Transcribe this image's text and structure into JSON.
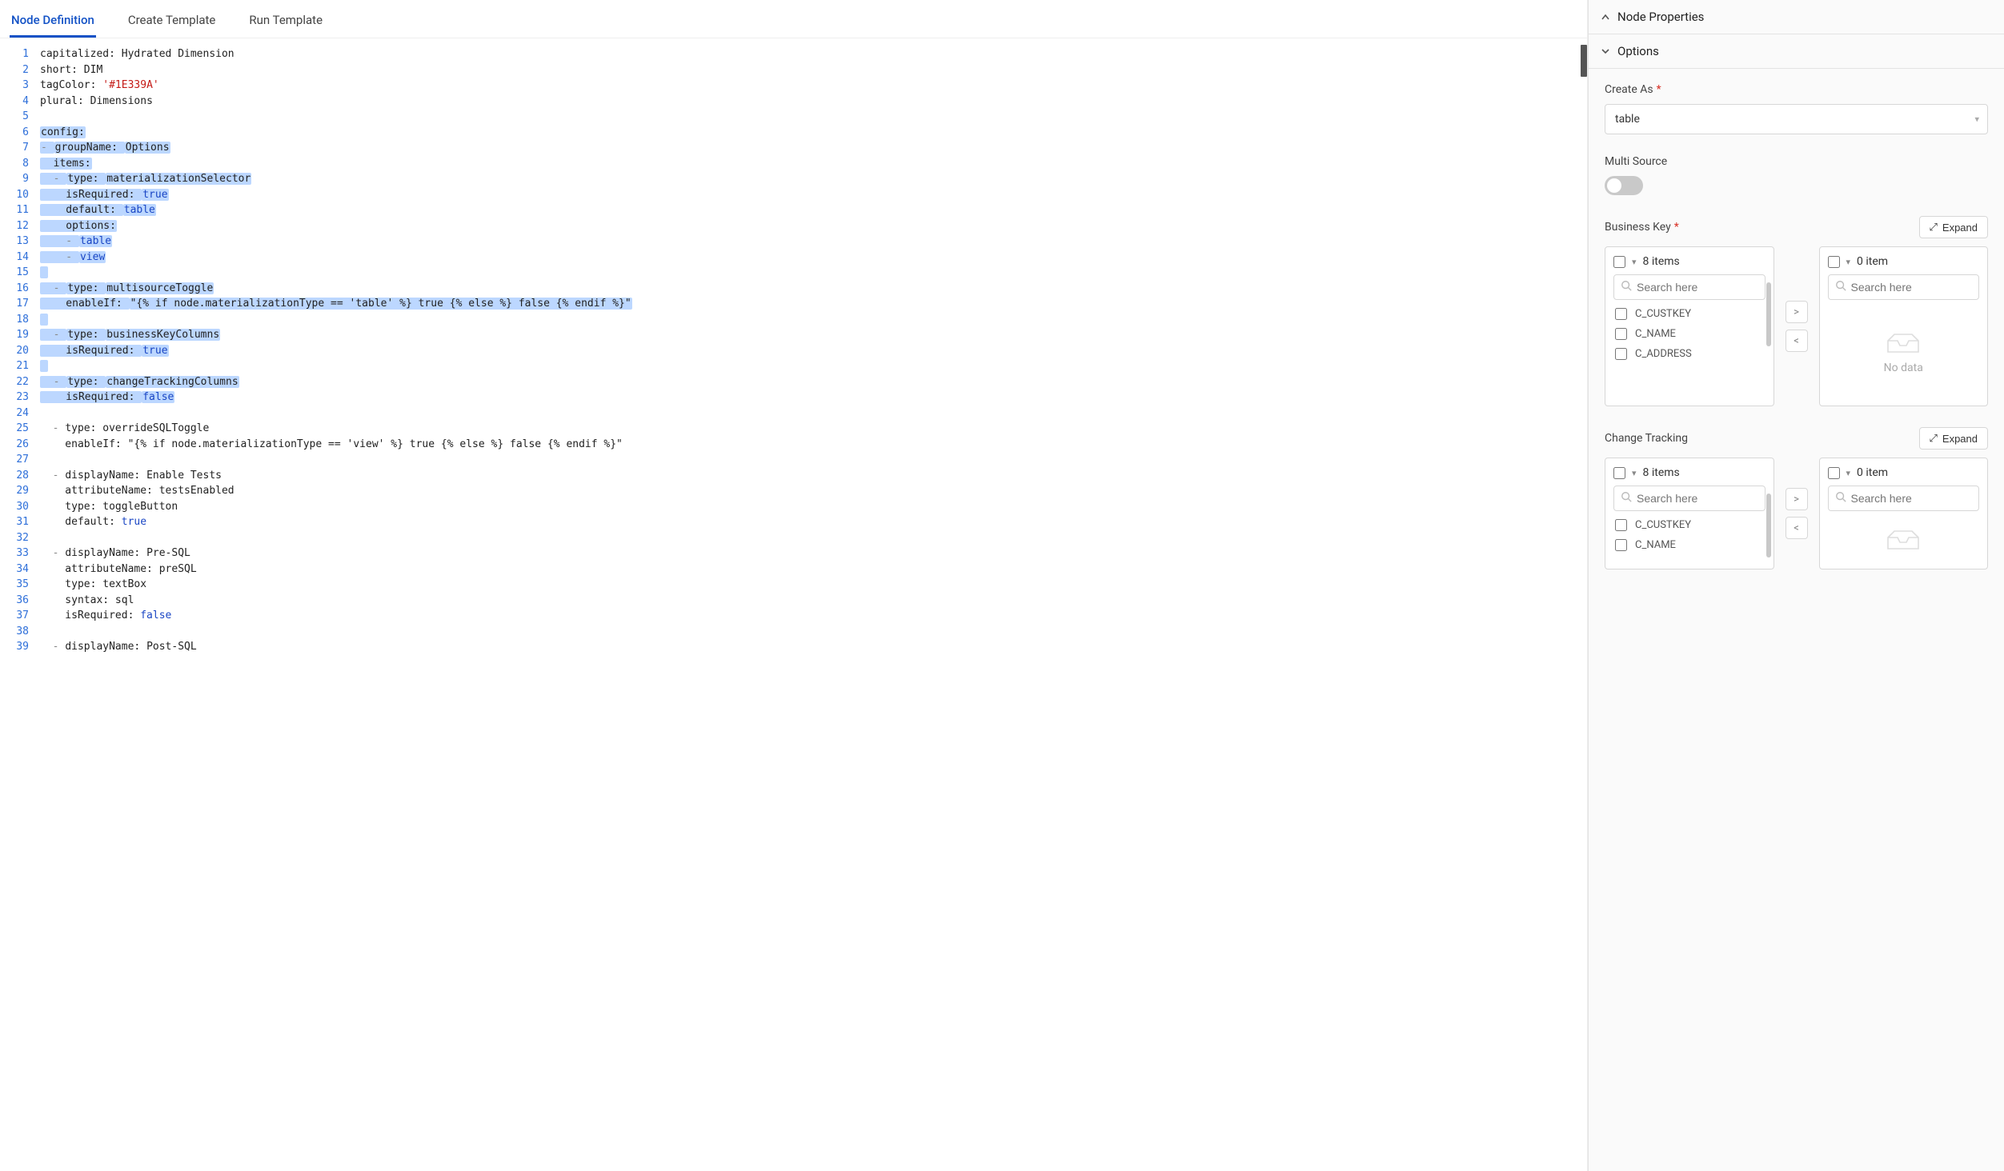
{
  "tabs": [
    {
      "label": "Node Definition",
      "active": true
    },
    {
      "label": "Create Template",
      "active": false
    },
    {
      "label": "Run Template",
      "active": false
    }
  ],
  "editor": {
    "lines": [
      {
        "n": 1,
        "segments": [
          {
            "t": "capitalized: ",
            "c": "tok-key"
          },
          {
            "t": "Hydrated Dimension",
            "c": ""
          }
        ]
      },
      {
        "n": 2,
        "segments": [
          {
            "t": "short: ",
            "c": "tok-key"
          },
          {
            "t": "DIM",
            "c": ""
          }
        ]
      },
      {
        "n": 3,
        "segments": [
          {
            "t": "tagColor: ",
            "c": "tok-key"
          },
          {
            "t": "'#1E339A'",
            "c": "tok-str"
          }
        ]
      },
      {
        "n": 4,
        "segments": [
          {
            "t": "plural: ",
            "c": "tok-key"
          },
          {
            "t": "Dimensions",
            "c": ""
          }
        ]
      },
      {
        "n": 5,
        "segments": []
      },
      {
        "n": 6,
        "segments": [
          {
            "t": "config:",
            "c": "tok-key",
            "hl": true
          }
        ]
      },
      {
        "n": 7,
        "segments": [
          {
            "t": "- ",
            "c": "tok-dash",
            "hl": true
          },
          {
            "t": "groupName: ",
            "c": "tok-key",
            "hl": true
          },
          {
            "t": "Options",
            "c": "",
            "hl": true
          }
        ]
      },
      {
        "n": 8,
        "segments": [
          {
            "t": "  items:",
            "c": "tok-key",
            "hl": true
          }
        ]
      },
      {
        "n": 9,
        "segments": [
          {
            "t": "  - ",
            "c": "tok-dash",
            "hl": true
          },
          {
            "t": "type: ",
            "c": "tok-key",
            "hl": true
          },
          {
            "t": "materializationSelector",
            "c": "",
            "hl": true
          }
        ]
      },
      {
        "n": 10,
        "segments": [
          {
            "t": "    isRequired: ",
            "c": "tok-key",
            "hl": true
          },
          {
            "t": "true",
            "c": "tok-bool",
            "hl": true
          }
        ]
      },
      {
        "n": 11,
        "segments": [
          {
            "t": "    default: ",
            "c": "tok-key",
            "hl": true
          },
          {
            "t": "table",
            "c": "tok-bool",
            "hl": true
          }
        ]
      },
      {
        "n": 12,
        "segments": [
          {
            "t": "    options:",
            "c": "tok-key",
            "hl": true
          }
        ]
      },
      {
        "n": 13,
        "segments": [
          {
            "t": "    - ",
            "c": "tok-dash",
            "hl": true
          },
          {
            "t": "table",
            "c": "tok-bool",
            "hl": true
          }
        ]
      },
      {
        "n": 14,
        "segments": [
          {
            "t": "    - ",
            "c": "tok-dash",
            "hl": true
          },
          {
            "t": "view",
            "c": "tok-bool",
            "hl": true
          }
        ]
      },
      {
        "n": 15,
        "segments": [
          {
            "t": " ",
            "c": "",
            "hl": true
          }
        ]
      },
      {
        "n": 16,
        "segments": [
          {
            "t": "  - ",
            "c": "tok-dash",
            "hl": true
          },
          {
            "t": "type: ",
            "c": "tok-key",
            "hl": true
          },
          {
            "t": "multisourceToggle",
            "c": "",
            "hl": true
          }
        ]
      },
      {
        "n": 17,
        "segments": [
          {
            "t": "    enableIf: ",
            "c": "tok-key",
            "hl": true
          },
          {
            "t": "\"{% if node.materializationType == 'table' %} true {% else %} false {% endif %}\"",
            "c": "",
            "hl": true
          }
        ]
      },
      {
        "n": 18,
        "segments": [
          {
            "t": " ",
            "c": "",
            "hl": true
          }
        ]
      },
      {
        "n": 19,
        "segments": [
          {
            "t": "  - ",
            "c": "tok-dash",
            "hl": true
          },
          {
            "t": "type: ",
            "c": "tok-key",
            "hl": true
          },
          {
            "t": "businessKeyColumns",
            "c": "",
            "hl": true
          }
        ]
      },
      {
        "n": 20,
        "segments": [
          {
            "t": "    isRequired: ",
            "c": "tok-key",
            "hl": true
          },
          {
            "t": "true",
            "c": "tok-bool",
            "hl": true
          }
        ]
      },
      {
        "n": 21,
        "segments": [
          {
            "t": " ",
            "c": "",
            "hl": true
          }
        ]
      },
      {
        "n": 22,
        "segments": [
          {
            "t": "  - ",
            "c": "tok-dash",
            "hl": true
          },
          {
            "t": "type: ",
            "c": "tok-key",
            "hl": true
          },
          {
            "t": "changeTrackingColumns",
            "c": "",
            "hl": true
          }
        ]
      },
      {
        "n": 23,
        "segments": [
          {
            "t": "    isRequired: ",
            "c": "tok-key",
            "hl": true
          },
          {
            "t": "false",
            "c": "tok-bool",
            "hl": true
          }
        ]
      },
      {
        "n": 24,
        "segments": []
      },
      {
        "n": 25,
        "segments": [
          {
            "t": "  - ",
            "c": "tok-dash"
          },
          {
            "t": "type: ",
            "c": "tok-key"
          },
          {
            "t": "overrideSQLToggle",
            "c": ""
          }
        ]
      },
      {
        "n": 26,
        "segments": [
          {
            "t": "    enableIf: ",
            "c": "tok-key"
          },
          {
            "t": "\"{% if node.materializationType == 'view' %} true {% else %} false {% endif %}\"",
            "c": ""
          }
        ]
      },
      {
        "n": 27,
        "segments": []
      },
      {
        "n": 28,
        "segments": [
          {
            "t": "  - ",
            "c": "tok-dash"
          },
          {
            "t": "displayName: ",
            "c": "tok-key"
          },
          {
            "t": "Enable Tests",
            "c": ""
          }
        ]
      },
      {
        "n": 29,
        "segments": [
          {
            "t": "    attributeName: ",
            "c": "tok-key"
          },
          {
            "t": "testsEnabled",
            "c": ""
          }
        ]
      },
      {
        "n": 30,
        "segments": [
          {
            "t": "    type: ",
            "c": "tok-key"
          },
          {
            "t": "toggleButton",
            "c": ""
          }
        ]
      },
      {
        "n": 31,
        "segments": [
          {
            "t": "    default: ",
            "c": "tok-key"
          },
          {
            "t": "true",
            "c": "tok-bool"
          }
        ]
      },
      {
        "n": 32,
        "segments": []
      },
      {
        "n": 33,
        "segments": [
          {
            "t": "  - ",
            "c": "tok-dash"
          },
          {
            "t": "displayName: ",
            "c": "tok-key"
          },
          {
            "t": "Pre-SQL",
            "c": ""
          }
        ]
      },
      {
        "n": 34,
        "segments": [
          {
            "t": "    attributeName: ",
            "c": "tok-key"
          },
          {
            "t": "preSQL",
            "c": ""
          }
        ]
      },
      {
        "n": 35,
        "segments": [
          {
            "t": "    type: ",
            "c": "tok-key"
          },
          {
            "t": "textBox",
            "c": ""
          }
        ]
      },
      {
        "n": 36,
        "segments": [
          {
            "t": "    syntax: ",
            "c": "tok-key"
          },
          {
            "t": "sql",
            "c": ""
          }
        ]
      },
      {
        "n": 37,
        "segments": [
          {
            "t": "    isRequired: ",
            "c": "tok-key"
          },
          {
            "t": "false",
            "c": "tok-bool"
          }
        ]
      },
      {
        "n": 38,
        "segments": []
      },
      {
        "n": 39,
        "segments": [
          {
            "t": "  - ",
            "c": "tok-dash"
          },
          {
            "t": "displayName: ",
            "c": "tok-key"
          },
          {
            "t": "Post-SQL",
            "c": ""
          }
        ]
      }
    ]
  },
  "right": {
    "sections": {
      "node_properties": {
        "label": "Node Properties",
        "collapsed": true
      },
      "options": {
        "label": "Options",
        "collapsed": false
      }
    },
    "create_as": {
      "label": "Create As",
      "required": true,
      "value": "table"
    },
    "multi_source": {
      "label": "Multi Source",
      "on": false
    },
    "expand_label": "Expand",
    "search_placeholder": "Search here",
    "no_data_label": "No data",
    "business_key": {
      "label": "Business Key",
      "required": true,
      "left_count": "8 items",
      "right_count": "0 item",
      "items": [
        "C_CUSTKEY",
        "C_NAME",
        "C_ADDRESS"
      ]
    },
    "change_tracking": {
      "label": "Change Tracking",
      "required": false,
      "left_count": "8 items",
      "right_count": "0 item",
      "items": [
        "C_CUSTKEY",
        "C_NAME"
      ]
    }
  }
}
